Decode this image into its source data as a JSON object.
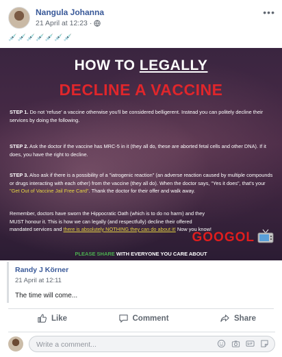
{
  "post": {
    "author": "Nangula Johanna",
    "timestamp": "21 April at 12:23",
    "more_label": "•••",
    "emoji_row": "💉💉💉💉💉💉💉"
  },
  "image": {
    "title_line1": "HOW TO",
    "title_line1_underlined": "LEGALLY",
    "title_line2": "DECLINE A VACCINE",
    "step1_label": "STEP 1.",
    "step1_text": "Do not 'refuse' a vaccine otherwise you'll be considered belligerent. Instead you can politely decline their services by doing the following.",
    "step2_label": "STEP 2.",
    "step2_text": "Ask the doctor if the vaccine has MRC-5 in it (they all do, these are aborted fetal cells and other DNA). If it does, you have the right to decline.",
    "step3_label": "STEP 3.",
    "step3_text_a": "Also ask if there is a possibility of a \"iatrogenic reaction\" (an adverse reaction caused by multiple compounds or drugs interacting with each other) from the vaccine (they all do). When the doctor says, \"Yes it does\", that's your",
    "step3_yellow": "\"Get Out of Vaccine Jail Free Card\"",
    "step3_text_b": ". Thank the doctor for their offer and walk away.",
    "remember_text": "Remember, doctors have sworn the Hippocratic Oath (which is to do no harm) and they MUST honour it. This is how we can legally (and respectfully) decline their offered mandated services and",
    "remember_yellow": "there is absolutely NOTHING they can do about it!",
    "remember_end": " Now you know!",
    "brand": "GOOGOL",
    "share_green": "PLEASE SHARE",
    "share_rest": " WITH EVERYONE YOU CARE ABOUT"
  },
  "quote": {
    "author": "Randy J Körner",
    "timestamp": "21 April at 12:11",
    "text": "The time will come..."
  },
  "actions": {
    "like": "Like",
    "comment": "Comment",
    "share": "Share"
  },
  "comment_box": {
    "placeholder": "Write a comment..."
  },
  "colors": {
    "link_blue": "#385898",
    "warning_red": "#e0262b",
    "highlight_yellow": "#e7d542"
  }
}
